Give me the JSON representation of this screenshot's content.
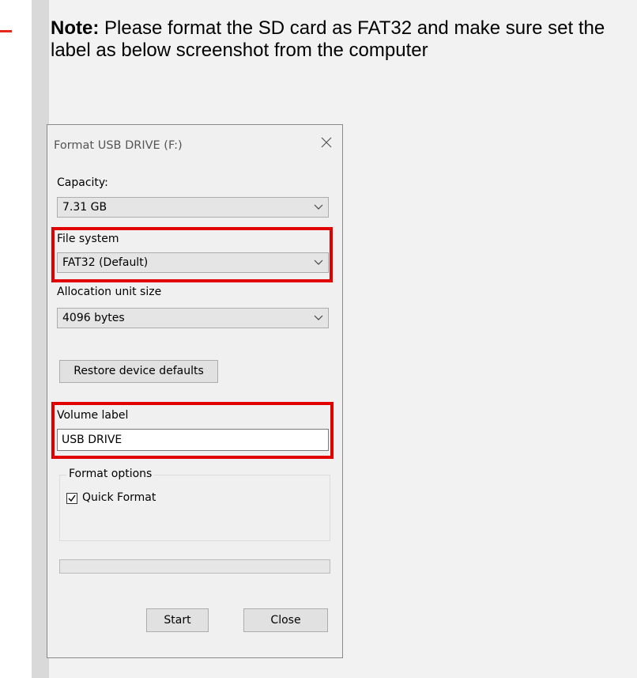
{
  "note": {
    "prefix": "Note:",
    "text": "Please format the SD card as FAT32 and make sure set the label as below screenshot from the computer"
  },
  "dialog": {
    "title": "Format USB DRIVE (F:)",
    "capacity_label": "Capacity:",
    "capacity_value": "7.31 GB",
    "filesystem_label": "File system",
    "filesystem_value": "FAT32 (Default)",
    "allocation_label": "Allocation unit size",
    "allocation_value": "4096 bytes",
    "restore_button": "Restore device defaults",
    "volume_label": "Volume label",
    "volume_value": "USB DRIVE",
    "format_options_label": "Format options",
    "quick_format_label": "Quick Format",
    "quick_format_checked": true,
    "progress": 0,
    "start_button": "Start",
    "close_button": "Close"
  },
  "colors": {
    "highlight": "#e00000",
    "accent_dash": "#e8281e"
  }
}
